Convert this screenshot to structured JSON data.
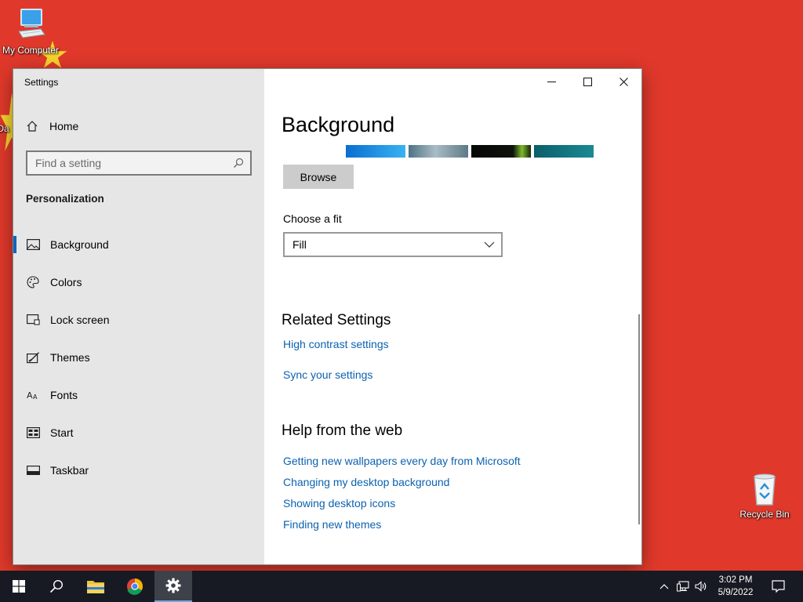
{
  "desktop": {
    "icons": [
      {
        "label": "My Computer"
      },
      {
        "label": "Da"
      },
      {
        "label": "Recycle Bin"
      }
    ]
  },
  "window": {
    "title": "Settings",
    "sidebar": {
      "home_label": "Home",
      "search_placeholder": "Find a setting",
      "section_heading": "Personalization",
      "items": [
        {
          "label": "Background",
          "icon": "picture-icon",
          "active": true
        },
        {
          "label": "Colors",
          "icon": "palette-icon"
        },
        {
          "label": "Lock screen",
          "icon": "lock-screen-icon"
        },
        {
          "label": "Themes",
          "icon": "themes-icon"
        },
        {
          "label": "Fonts",
          "icon": "fonts-icon"
        },
        {
          "label": "Start",
          "icon": "start-icon"
        },
        {
          "label": "Taskbar",
          "icon": "taskbar-icon"
        }
      ]
    },
    "content": {
      "page_title": "Background",
      "recent_images": [
        {
          "name": "recent-image-1",
          "color": "#1a8fe0"
        },
        {
          "name": "recent-image-2",
          "color": "#6f8a96"
        },
        {
          "name": "recent-image-3",
          "color": "#0b0f0b"
        },
        {
          "name": "recent-image-4",
          "color": "#0f6d78"
        }
      ],
      "browse_label": "Browse",
      "fit_label": "Choose a fit",
      "fit_value": "Fill",
      "related_heading": "Related Settings",
      "related_links": [
        "High contrast settings",
        "Sync your settings"
      ],
      "help_heading": "Help from the web",
      "help_links": [
        "Getting new wallpapers every day from Microsoft",
        "Changing my desktop background",
        "Showing desktop icons",
        "Finding new themes"
      ]
    }
  },
  "taskbar": {
    "time": "3:02 PM",
    "date": "5/9/2022"
  },
  "colors": {
    "desktop": "#e0392b",
    "accent": "#0067c0",
    "link": "#0b62b0",
    "taskbar": "#171a22"
  }
}
